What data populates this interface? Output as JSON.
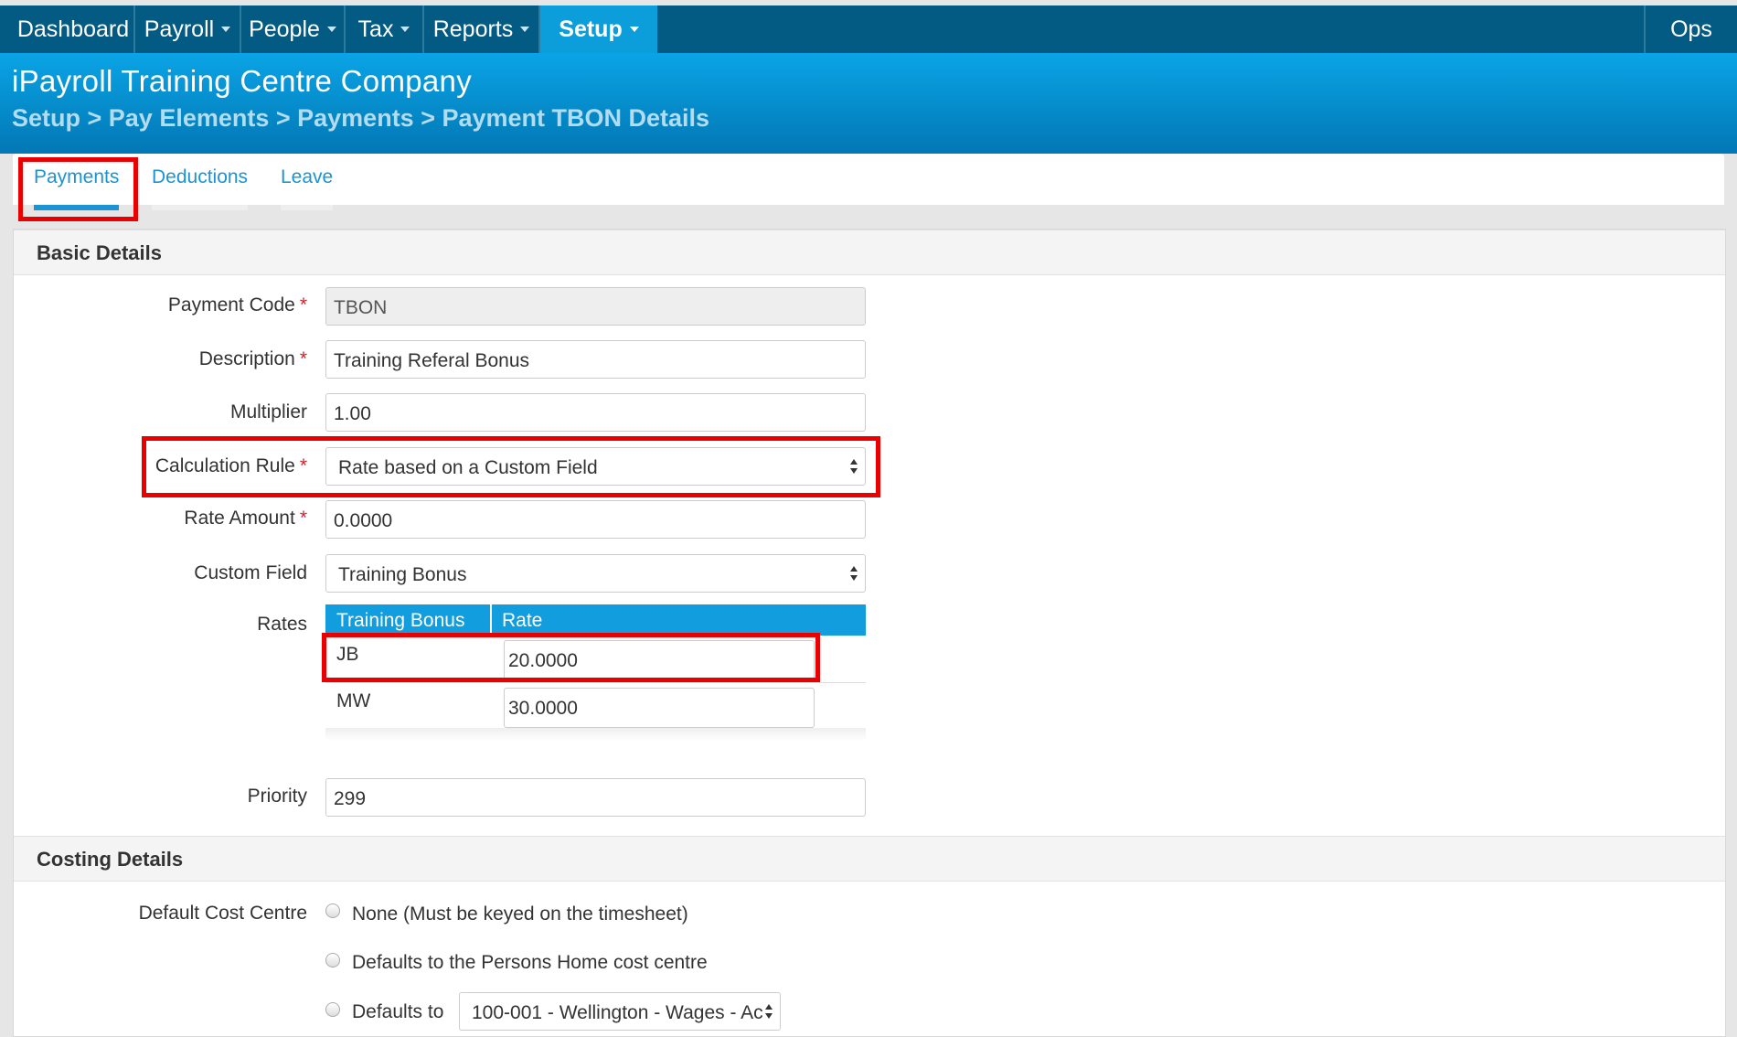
{
  "nav": {
    "items": [
      "Dashboard",
      "Payroll",
      "People",
      "Tax",
      "Reports",
      "Setup"
    ],
    "ops": "Ops",
    "active": "Setup"
  },
  "header": {
    "company": "iPayroll Training Centre Company",
    "breadcrumb": "Setup > Pay Elements > Payments > Payment TBON Details"
  },
  "tabs": [
    "Payments",
    "Deductions",
    "Leave"
  ],
  "basic": {
    "title": "Basic Details",
    "payment_code_label": "Payment Code",
    "payment_code": "TBON",
    "description_label": "Description",
    "description": "Training Referal Bonus",
    "multiplier_label": "Multiplier",
    "multiplier": "1.00",
    "calc_rule_label": "Calculation Rule",
    "calc_rule": "Rate based on a Custom Field",
    "rate_amount_label": "Rate Amount",
    "rate_amount": "0.0000",
    "custom_field_label": "Custom Field",
    "custom_field": "Training Bonus",
    "rates_label": "Rates",
    "rates_columns": [
      "Training Bonus",
      "Rate"
    ],
    "rates": [
      {
        "code": "JB",
        "rate": "20.0000"
      },
      {
        "code": "MW",
        "rate": "30.0000"
      }
    ],
    "priority_label": "Priority",
    "priority": "299",
    "required_mark": "*"
  },
  "costing": {
    "title": "Costing Details",
    "default_cost_centre_label": "Default Cost Centre",
    "options": [
      "None (Must be keyed on the timesheet)",
      "Defaults to the Persons Home cost centre",
      "Defaults to"
    ],
    "defaults_to_value": "100-001 - Wellington - Wages - Ac"
  },
  "colors": {
    "nav_bg": "#035a83",
    "nav_active": "#0c9ddb",
    "header_gradient_top": "#0aa4e6",
    "link_blue": "#1c94d3",
    "highlight_red": "#ea0000"
  }
}
